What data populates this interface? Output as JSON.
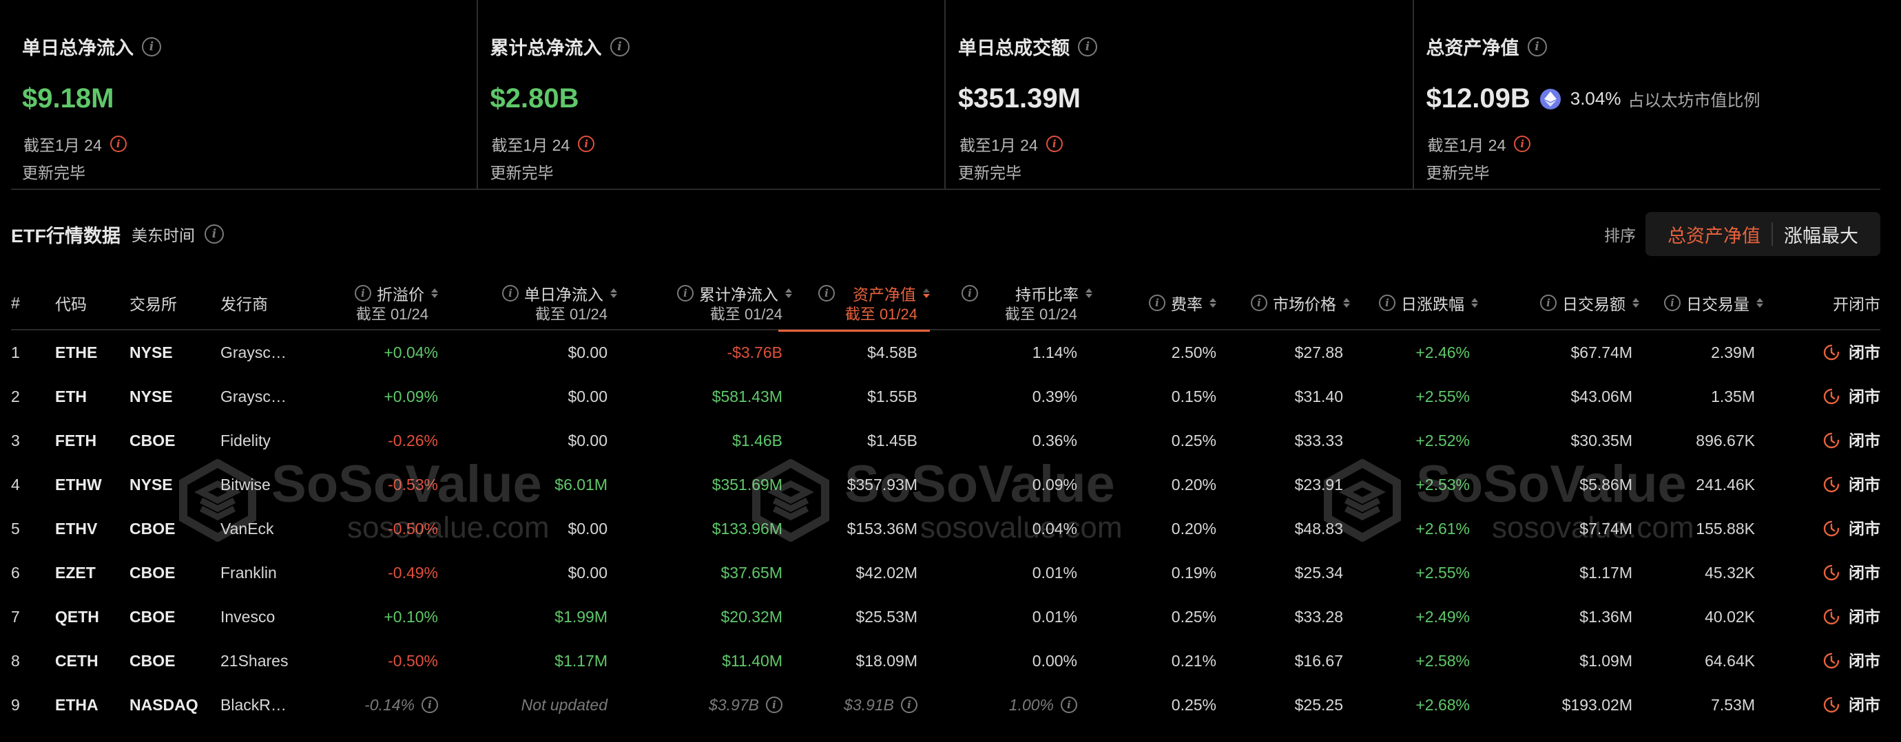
{
  "summary": [
    {
      "title": "单日总净流入",
      "value": "$9.18M",
      "date": "截至1月 24",
      "status": "更新完毕"
    },
    {
      "title": "累计总净流入",
      "value": "$2.80B",
      "date": "截至1月 24",
      "status": "更新完毕"
    },
    {
      "title": "单日总成交额",
      "value": "$351.39M",
      "date": "截至1月 24",
      "status": "更新完毕"
    },
    {
      "title": "总资产净值",
      "value": "$12.09B",
      "ratio": "3.04%",
      "ratio_label": "占以太坊市值比例",
      "date": "截至1月 24",
      "status": "更新完毕"
    }
  ],
  "section": {
    "title": "ETF行情数据",
    "timezone": "美东时间",
    "sort_label": "排序",
    "sort_options": [
      "总资产净值",
      "涨幅最大"
    ]
  },
  "table": {
    "headers": {
      "num": "#",
      "code": "代码",
      "exchange": "交易所",
      "issuer": "发行商",
      "premium": "折溢价",
      "premium_sub": "截至 01/24",
      "daily_flow": "单日净流入",
      "daily_flow_sub": "截至 01/24",
      "cum_flow": "累计净流入",
      "cum_flow_sub": "截至 01/24",
      "nav": "资产净值",
      "nav_sub": "截至 01/24",
      "holding": "持币比率",
      "holding_sub": "截至 01/24",
      "fee": "费率",
      "price": "市场价格",
      "change": "日涨跌幅",
      "value": "日交易额",
      "volume": "日交易量",
      "status": "开闭市"
    },
    "rows": [
      {
        "n": "1",
        "code": "ETHE",
        "ex": "NYSE",
        "issuer": "Graysc…",
        "premium": "+0.04%",
        "flow": "$0.00",
        "cum": "-$3.76B",
        "nav": "$4.58B",
        "hold": "1.14%",
        "fee": "2.50%",
        "price": "$27.88",
        "chg": "+2.46%",
        "val": "$67.74M",
        "vol": "2.39M",
        "status": "闭市"
      },
      {
        "n": "2",
        "code": "ETH",
        "ex": "NYSE",
        "issuer": "Graysc…",
        "premium": "+0.09%",
        "flow": "$0.00",
        "cum": "$581.43M",
        "nav": "$1.55B",
        "hold": "0.39%",
        "fee": "0.15%",
        "price": "$31.40",
        "chg": "+2.55%",
        "val": "$43.06M",
        "vol": "1.35M",
        "status": "闭市"
      },
      {
        "n": "3",
        "code": "FETH",
        "ex": "CBOE",
        "issuer": "Fidelity",
        "premium": "-0.26%",
        "flow": "$0.00",
        "cum": "$1.46B",
        "nav": "$1.45B",
        "hold": "0.36%",
        "fee": "0.25%",
        "price": "$33.33",
        "chg": "+2.52%",
        "val": "$30.35M",
        "vol": "896.67K",
        "status": "闭市"
      },
      {
        "n": "4",
        "code": "ETHW",
        "ex": "NYSE",
        "issuer": "Bitwise",
        "premium": "-0.53%",
        "flow": "$6.01M",
        "cum": "$351.69M",
        "nav": "$357.93M",
        "hold": "0.09%",
        "fee": "0.20%",
        "price": "$23.91",
        "chg": "+2.53%",
        "val": "$5.86M",
        "vol": "241.46K",
        "status": "闭市"
      },
      {
        "n": "5",
        "code": "ETHV",
        "ex": "CBOE",
        "issuer": "VanEck",
        "premium": "-0.50%",
        "flow": "$0.00",
        "cum": "$133.96M",
        "nav": "$153.36M",
        "hold": "0.04%",
        "fee": "0.20%",
        "price": "$48.83",
        "chg": "+2.61%",
        "val": "$7.74M",
        "vol": "155.88K",
        "status": "闭市"
      },
      {
        "n": "6",
        "code": "EZET",
        "ex": "CBOE",
        "issuer": "Franklin",
        "premium": "-0.49%",
        "flow": "$0.00",
        "cum": "$37.65M",
        "nav": "$42.02M",
        "hold": "0.01%",
        "fee": "0.19%",
        "price": "$25.34",
        "chg": "+2.55%",
        "val": "$1.17M",
        "vol": "45.32K",
        "status": "闭市"
      },
      {
        "n": "7",
        "code": "QETH",
        "ex": "CBOE",
        "issuer": "Invesco",
        "premium": "+0.10%",
        "flow": "$1.99M",
        "cum": "$20.32M",
        "nav": "$25.53M",
        "hold": "0.01%",
        "fee": "0.25%",
        "price": "$33.28",
        "chg": "+2.49%",
        "val": "$1.36M",
        "vol": "40.02K",
        "status": "闭市"
      },
      {
        "n": "8",
        "code": "CETH",
        "ex": "CBOE",
        "issuer": "21Shares",
        "premium": "-0.50%",
        "flow": "$1.17M",
        "cum": "$11.40M",
        "nav": "$18.09M",
        "hold": "0.00%",
        "fee": "0.21%",
        "price": "$16.67",
        "chg": "+2.58%",
        "val": "$1.09M",
        "vol": "64.64K",
        "status": "闭市"
      },
      {
        "n": "9",
        "code": "ETHA",
        "ex": "NASDAQ",
        "issuer": "BlackR…",
        "premium": "-0.14%",
        "flow": "Not updated",
        "cum": "$3.97B",
        "nav": "$3.91B",
        "hold": "1.00%",
        "fee": "0.25%",
        "price": "$25.25",
        "chg": "+2.68%",
        "val": "$193.02M",
        "vol": "7.53M",
        "status": "闭市"
      }
    ]
  },
  "watermark": {
    "name": "SoSoValue",
    "url": "sosovalue.com"
  },
  "colors": {
    "positive": "#5fc86a",
    "negative": "#e0503d",
    "accent": "#e8623d",
    "eth_badge": "#6c7be8"
  }
}
